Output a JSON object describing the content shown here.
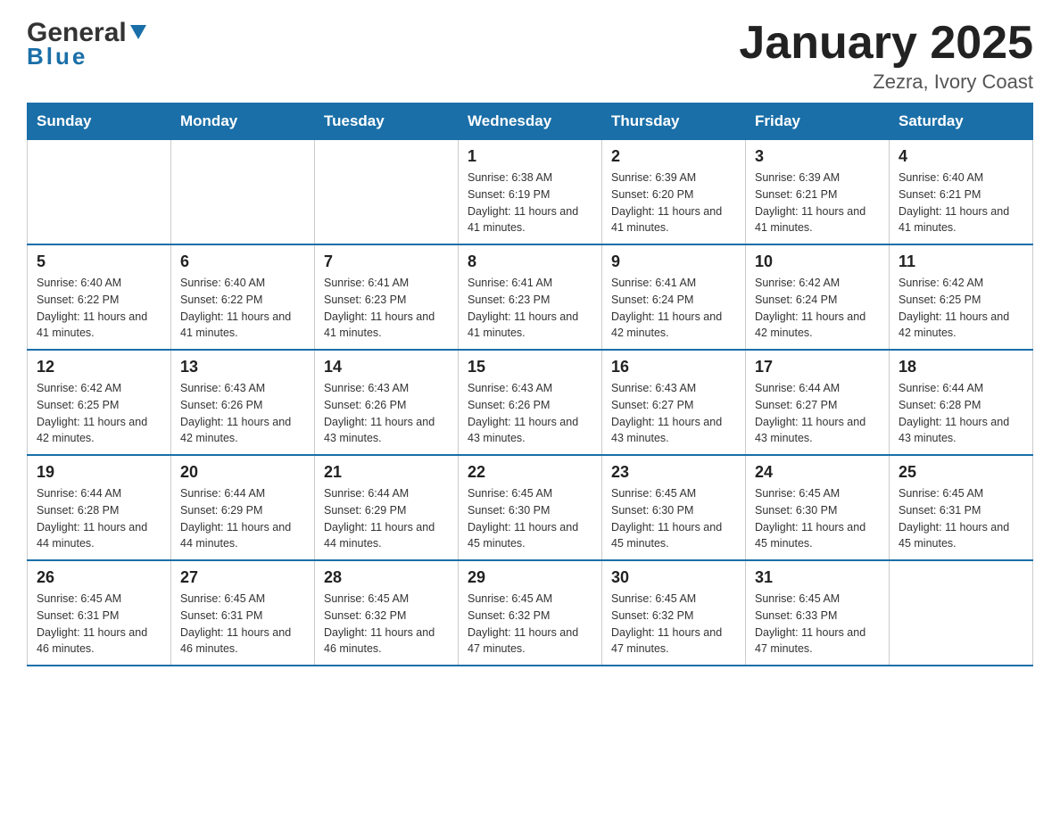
{
  "logo": {
    "general": "General",
    "blue": "Blue"
  },
  "title": "January 2025",
  "subtitle": "Zezra, Ivory Coast",
  "days_of_week": [
    "Sunday",
    "Monday",
    "Tuesday",
    "Wednesday",
    "Thursday",
    "Friday",
    "Saturday"
  ],
  "weeks": [
    [
      {
        "day": "",
        "info": ""
      },
      {
        "day": "",
        "info": ""
      },
      {
        "day": "",
        "info": ""
      },
      {
        "day": "1",
        "info": "Sunrise: 6:38 AM\nSunset: 6:19 PM\nDaylight: 11 hours and 41 minutes."
      },
      {
        "day": "2",
        "info": "Sunrise: 6:39 AM\nSunset: 6:20 PM\nDaylight: 11 hours and 41 minutes."
      },
      {
        "day": "3",
        "info": "Sunrise: 6:39 AM\nSunset: 6:21 PM\nDaylight: 11 hours and 41 minutes."
      },
      {
        "day": "4",
        "info": "Sunrise: 6:40 AM\nSunset: 6:21 PM\nDaylight: 11 hours and 41 minutes."
      }
    ],
    [
      {
        "day": "5",
        "info": "Sunrise: 6:40 AM\nSunset: 6:22 PM\nDaylight: 11 hours and 41 minutes."
      },
      {
        "day": "6",
        "info": "Sunrise: 6:40 AM\nSunset: 6:22 PM\nDaylight: 11 hours and 41 minutes."
      },
      {
        "day": "7",
        "info": "Sunrise: 6:41 AM\nSunset: 6:23 PM\nDaylight: 11 hours and 41 minutes."
      },
      {
        "day": "8",
        "info": "Sunrise: 6:41 AM\nSunset: 6:23 PM\nDaylight: 11 hours and 41 minutes."
      },
      {
        "day": "9",
        "info": "Sunrise: 6:41 AM\nSunset: 6:24 PM\nDaylight: 11 hours and 42 minutes."
      },
      {
        "day": "10",
        "info": "Sunrise: 6:42 AM\nSunset: 6:24 PM\nDaylight: 11 hours and 42 minutes."
      },
      {
        "day": "11",
        "info": "Sunrise: 6:42 AM\nSunset: 6:25 PM\nDaylight: 11 hours and 42 minutes."
      }
    ],
    [
      {
        "day": "12",
        "info": "Sunrise: 6:42 AM\nSunset: 6:25 PM\nDaylight: 11 hours and 42 minutes."
      },
      {
        "day": "13",
        "info": "Sunrise: 6:43 AM\nSunset: 6:26 PM\nDaylight: 11 hours and 42 minutes."
      },
      {
        "day": "14",
        "info": "Sunrise: 6:43 AM\nSunset: 6:26 PM\nDaylight: 11 hours and 43 minutes."
      },
      {
        "day": "15",
        "info": "Sunrise: 6:43 AM\nSunset: 6:26 PM\nDaylight: 11 hours and 43 minutes."
      },
      {
        "day": "16",
        "info": "Sunrise: 6:43 AM\nSunset: 6:27 PM\nDaylight: 11 hours and 43 minutes."
      },
      {
        "day": "17",
        "info": "Sunrise: 6:44 AM\nSunset: 6:27 PM\nDaylight: 11 hours and 43 minutes."
      },
      {
        "day": "18",
        "info": "Sunrise: 6:44 AM\nSunset: 6:28 PM\nDaylight: 11 hours and 43 minutes."
      }
    ],
    [
      {
        "day": "19",
        "info": "Sunrise: 6:44 AM\nSunset: 6:28 PM\nDaylight: 11 hours and 44 minutes."
      },
      {
        "day": "20",
        "info": "Sunrise: 6:44 AM\nSunset: 6:29 PM\nDaylight: 11 hours and 44 minutes."
      },
      {
        "day": "21",
        "info": "Sunrise: 6:44 AM\nSunset: 6:29 PM\nDaylight: 11 hours and 44 minutes."
      },
      {
        "day": "22",
        "info": "Sunrise: 6:45 AM\nSunset: 6:30 PM\nDaylight: 11 hours and 45 minutes."
      },
      {
        "day": "23",
        "info": "Sunrise: 6:45 AM\nSunset: 6:30 PM\nDaylight: 11 hours and 45 minutes."
      },
      {
        "day": "24",
        "info": "Sunrise: 6:45 AM\nSunset: 6:30 PM\nDaylight: 11 hours and 45 minutes."
      },
      {
        "day": "25",
        "info": "Sunrise: 6:45 AM\nSunset: 6:31 PM\nDaylight: 11 hours and 45 minutes."
      }
    ],
    [
      {
        "day": "26",
        "info": "Sunrise: 6:45 AM\nSunset: 6:31 PM\nDaylight: 11 hours and 46 minutes."
      },
      {
        "day": "27",
        "info": "Sunrise: 6:45 AM\nSunset: 6:31 PM\nDaylight: 11 hours and 46 minutes."
      },
      {
        "day": "28",
        "info": "Sunrise: 6:45 AM\nSunset: 6:32 PM\nDaylight: 11 hours and 46 minutes."
      },
      {
        "day": "29",
        "info": "Sunrise: 6:45 AM\nSunset: 6:32 PM\nDaylight: 11 hours and 47 minutes."
      },
      {
        "day": "30",
        "info": "Sunrise: 6:45 AM\nSunset: 6:32 PM\nDaylight: 11 hours and 47 minutes."
      },
      {
        "day": "31",
        "info": "Sunrise: 6:45 AM\nSunset: 6:33 PM\nDaylight: 11 hours and 47 minutes."
      },
      {
        "day": "",
        "info": ""
      }
    ]
  ]
}
